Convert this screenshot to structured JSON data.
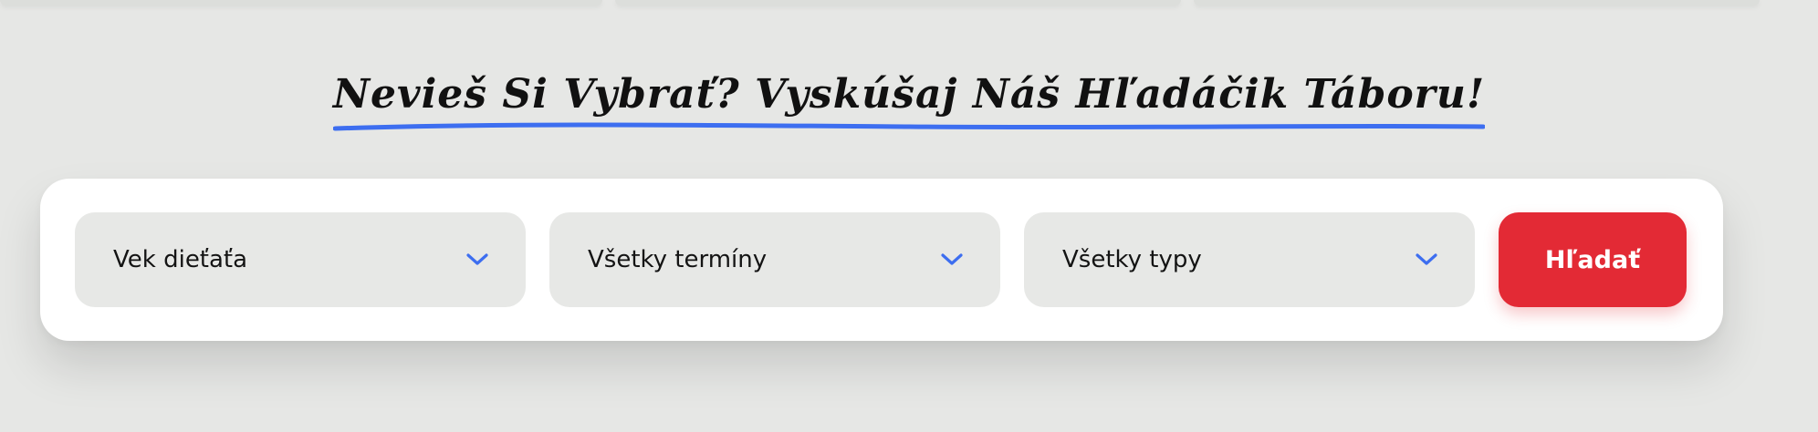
{
  "headline": "Nevieš Si Vybrať? Vyskúšaj Náš Hľadáčik Táboru!",
  "colors": {
    "background": "#e6e7e5",
    "card": "#ffffff",
    "select_bg": "#e7e8e6",
    "accent_blue": "#3d6ef0",
    "button_red": "#e32a35"
  },
  "filters": [
    {
      "label": "Vek dieťaťa",
      "icon": "chevron-down-icon"
    },
    {
      "label": "Všetky termíny",
      "icon": "chevron-down-icon"
    },
    {
      "label": "Všetky typy",
      "icon": "chevron-down-icon"
    }
  ],
  "search_button": {
    "label": "Hľadať"
  }
}
